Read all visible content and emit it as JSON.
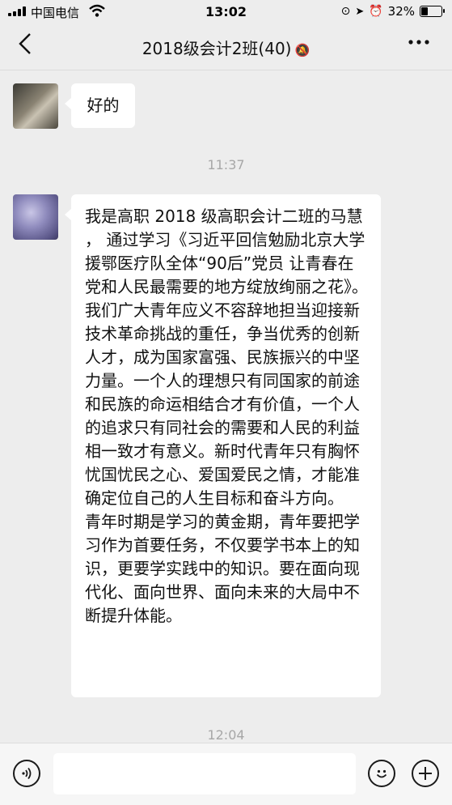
{
  "status_bar": {
    "carrier": "中国电信",
    "time": "13:02",
    "battery": "32%",
    "battery_level": 0.32,
    "icons": [
      "signal-icon",
      "wifi-icon",
      "orientation-lock-icon",
      "location-icon",
      "alarm-icon",
      "battery-icon"
    ]
  },
  "nav": {
    "title": "2018级会计2班(40)",
    "back_icon": "chevron-left-icon",
    "mute_icon": "bell-muted-icon",
    "more_icon": "more-icon"
  },
  "messages": [
    {
      "type": "text",
      "sender": "other",
      "text": "好的"
    },
    {
      "type": "time",
      "text": "11:37"
    },
    {
      "type": "text",
      "sender": "other",
      "paragraphs": [
        "我是高职 2018 级高职会计二班的马慧 ， 通过学习《习近平回信勉励北京大学援鄂医疗队全体“90后”党员 让青春在党和人民最需要的地方绽放绚丽之花》。",
        "我们广大青年应义不容辞地担当迎接新技术革命挑战的重任，争当优秀的创新人才，成为国家富强、民族振兴的中坚力量。一个人的理想只有同国家的前途和民族的命运相结合才有价值，一个人的追求只有同社会的需要和人民的利益相一致才有意义。新时代青年只有胸怀忧国忧民之心、爱国爱民之情，才能准确定位自己的人生目标和奋斗方向。",
        "青年时期是学习的黄金期，青年要把学习作为首要任务，不仅要学书本上的知识，更要学实践中的知识。要在面向现代化、面向世界、面向未来的大局中不断提升体能。"
      ]
    },
    {
      "type": "time",
      "text": "12:04"
    }
  ],
  "input_bar": {
    "voice_icon": "voice-icon",
    "emoji_icon": "emoji-icon",
    "plus_icon": "plus-icon",
    "placeholder": ""
  }
}
